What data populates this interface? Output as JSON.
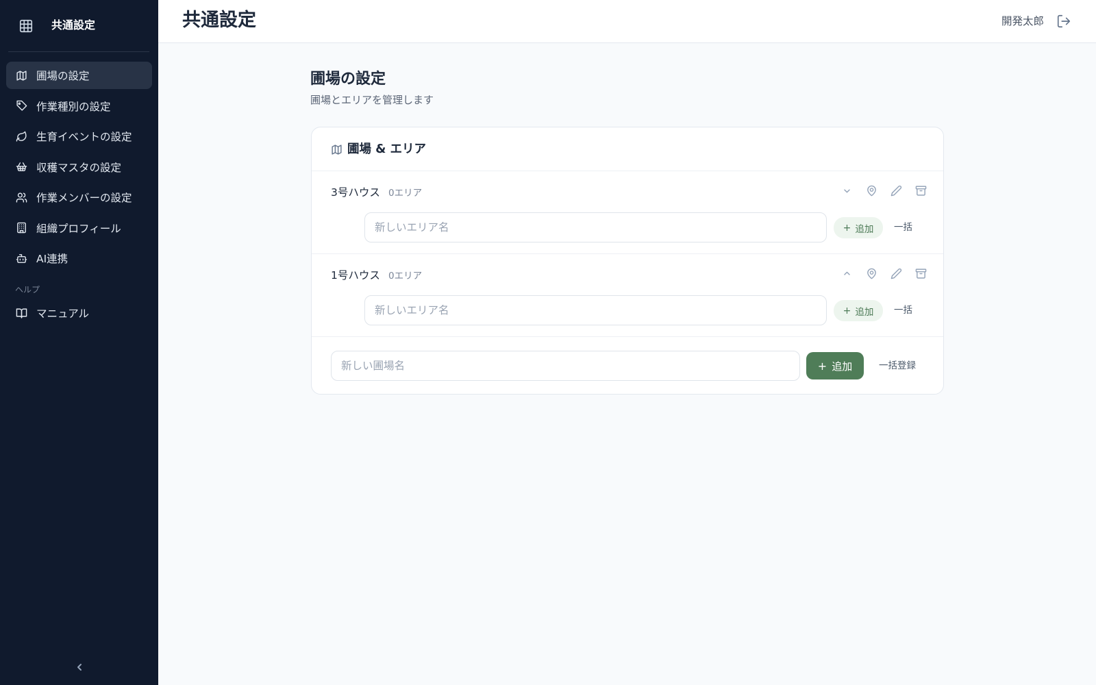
{
  "colors": {
    "sidebar_bg": "#101a2d",
    "active_nav_bg": "#283346",
    "accent_green": "#4f7d58",
    "accent_green_light": "#edf5ee"
  },
  "sidebar": {
    "title": "共通設定",
    "logo_icon": "grid-icon",
    "items": [
      {
        "label": "圃場の設定",
        "icon": "map-icon",
        "active": true
      },
      {
        "label": "作業種別の設定",
        "icon": "tag-icon",
        "active": false
      },
      {
        "label": "生育イベントの設定",
        "icon": "leaf-icon",
        "active": false
      },
      {
        "label": "収穫マスタの設定",
        "icon": "basket-icon",
        "active": false
      },
      {
        "label": "作業メンバーの設定",
        "icon": "users-icon",
        "active": false
      },
      {
        "label": "組織プロフィール",
        "icon": "building-icon",
        "active": false
      },
      {
        "label": "AI連携",
        "icon": "bot-icon",
        "active": false
      }
    ],
    "help_section_label": "ヘルプ",
    "help_items": [
      {
        "label": "マニュアル",
        "icon": "book-icon"
      }
    ],
    "collapse_icon": "chevron-left-icon"
  },
  "header": {
    "title": "共通設定",
    "user_name": "開発太郎",
    "logout_icon": "logout-icon"
  },
  "main": {
    "title": "圃場の設定",
    "subtitle": "圃場とエリアを管理します",
    "card": {
      "title": "圃場 & エリア",
      "icon": "map-icon",
      "fields": [
        {
          "name": "3号ハウス",
          "area_count": "0エリア",
          "expanded": false,
          "area_placeholder": "新しいエリア名",
          "add_label": "追加",
          "bulk_label": "一括"
        },
        {
          "name": "1号ハウス",
          "area_count": "0エリア",
          "expanded": true,
          "area_placeholder": "新しいエリア名",
          "add_label": "追加",
          "bulk_label": "一括"
        }
      ],
      "new_field_placeholder": "新しい圃場名",
      "add_label": "追加",
      "bulk_register_label": "一括登録"
    }
  }
}
